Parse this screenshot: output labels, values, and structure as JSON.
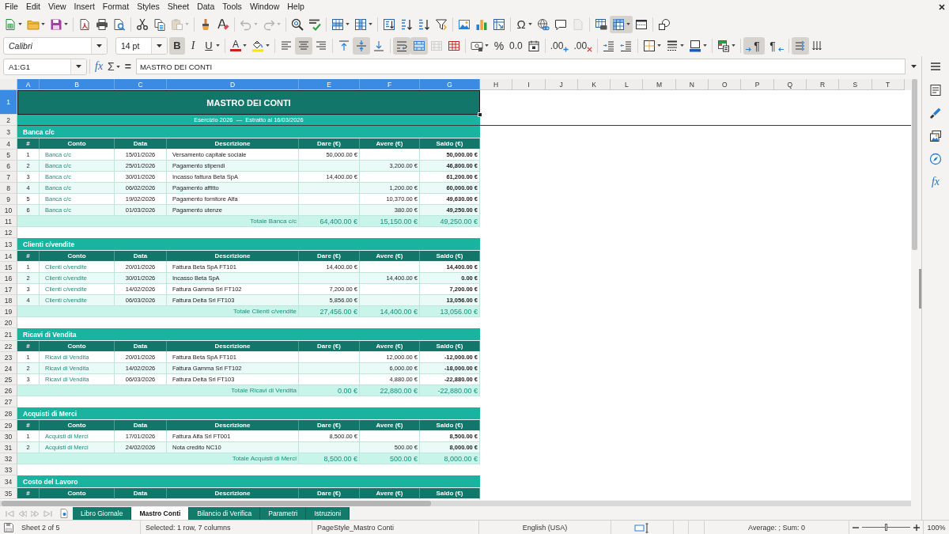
{
  "menu_bar": {
    "items": [
      "File",
      "Edit",
      "View",
      "Insert",
      "Format",
      "Styles",
      "Sheet",
      "Data",
      "Tools",
      "Window",
      "Help"
    ]
  },
  "standard_toolbar": {
    "paste": {
      "disabled": true
    },
    "undo": {
      "disabled": true
    },
    "redo": {
      "disabled": true
    },
    "special_character": {
      "label": "Ω"
    },
    "headers_footers": {
      "disabled": true
    },
    "freeze_rows_columns": {
      "on": true
    }
  },
  "formatting_toolbar": {
    "font_name": "Calibri",
    "font_size": "14 pt",
    "bold": {
      "label": "B",
      "on": true
    },
    "italic": {
      "label": "I",
      "on": false
    },
    "underline": {
      "label": "U",
      "on": false
    },
    "font_color": {
      "label": "A"
    },
    "align_left": {
      "on": false
    },
    "align_center": {
      "on": true
    },
    "align_right": {
      "on": false
    },
    "align_top": {
      "on": false
    },
    "center_vertically": {
      "on": true
    },
    "align_bottom": {
      "on": false
    },
    "wrap_text": {
      "on": true
    },
    "merge_and_center": {
      "on": true
    },
    "merge_cells": {
      "disabled": true
    },
    "percent": {
      "label": "%"
    },
    "number": {
      "label": "0.0"
    },
    "add_decimal_place": {
      "label": ".00"
    },
    "delete_decimal_place": {
      "label": ".00"
    },
    "left_to_right": {
      "label": "¶",
      "on": true
    },
    "right_to_left": {
      "label": "¶",
      "on": false
    },
    "text_left_to_right": {
      "on": true
    },
    "text_top_to_bottom": {
      "on": false
    }
  },
  "formula_bar": {
    "name_box": "A1:G1",
    "function_wizard": {
      "label": "fx"
    },
    "sum": {
      "label": "Σ"
    },
    "formula": {
      "label": "="
    },
    "content": "MASTRO DEI CONTI"
  },
  "sheet": {
    "columns": [
      {
        "label": "A",
        "selected": true
      },
      {
        "label": "B",
        "selected": true
      },
      {
        "label": "C",
        "selected": true
      },
      {
        "label": "D",
        "selected": true
      },
      {
        "label": "E",
        "selected": true
      },
      {
        "label": "F",
        "selected": true
      },
      {
        "label": "G",
        "selected": true
      },
      {
        "label": "H",
        "selected": false
      },
      {
        "label": "I",
        "selected": false
      },
      {
        "label": "J",
        "selected": false
      },
      {
        "label": "K",
        "selected": false
      },
      {
        "label": "L",
        "selected": false
      },
      {
        "label": "M",
        "selected": false
      },
      {
        "label": "N",
        "selected": false
      },
      {
        "label": "O",
        "selected": false
      },
      {
        "label": "P",
        "selected": false
      },
      {
        "label": "Q",
        "selected": false
      },
      {
        "label": "R",
        "selected": false
      },
      {
        "label": "S",
        "selected": false
      },
      {
        "label": "T",
        "selected": false
      }
    ],
    "rows": [
      {
        "number": "1",
        "selected": true,
        "kind": "title",
        "text": "MASTRO DEI CONTI"
      },
      {
        "number": "2",
        "selected": false,
        "kind": "subtitle",
        "text": "Esercizio 2026  —  Estratto al 16/03/2026"
      },
      {
        "number": "3",
        "selected": false,
        "kind": "section",
        "text": "Banca c/c"
      },
      {
        "number": "4",
        "selected": false,
        "kind": "column_headers",
        "cells": [
          "#",
          "Conto",
          "Data",
          "Descrizione",
          "Dare (€)",
          "Avere (€)",
          "Saldo (€)"
        ]
      },
      {
        "number": "5",
        "selected": false,
        "kind": "entry",
        "index": "1",
        "account": "Banca c/c",
        "date": "15/01/2026",
        "description": "Versamento capitale sociale",
        "debit": "50,000.00 €",
        "balance": "50,000.00 €"
      },
      {
        "number": "6",
        "selected": false,
        "kind": "entry",
        "index": "2",
        "account": "Banca c/c",
        "date": "25/01/2026",
        "description": "Pagamento stipendi",
        "credit": "3,200.00 €",
        "balance": "46,800.00 €"
      },
      {
        "number": "7",
        "selected": false,
        "kind": "entry",
        "index": "3",
        "account": "Banca c/c",
        "date": "30/01/2026",
        "description": "Incasso fattura Beta SpA",
        "debit": "14,400.00 €",
        "balance": "61,200.00 €"
      },
      {
        "number": "8",
        "selected": false,
        "kind": "entry",
        "index": "4",
        "account": "Banca c/c",
        "date": "06/02/2026",
        "description": "Pagamento affitto",
        "credit": "1,200.00 €",
        "balance": "60,000.00 €"
      },
      {
        "number": "9",
        "selected": false,
        "kind": "entry",
        "index": "5",
        "account": "Banca c/c",
        "date": "19/02/2026",
        "description": "Pagamento fornitore Alfa",
        "credit": "10,370.00 €",
        "balance": "49,630.00 €"
      },
      {
        "number": "10",
        "selected": false,
        "kind": "entry",
        "index": "6",
        "account": "Banca c/c",
        "date": "01/03/2026",
        "description": "Pagamento utenze",
        "credit": "380.00 €",
        "balance": "49,250.00 €"
      },
      {
        "number": "11",
        "selected": false,
        "kind": "total",
        "label": "Totale Banca c/c",
        "debit": "64,400.00 €",
        "credit": "15,150.00 €",
        "balance": "49,250.00 €"
      },
      {
        "number": "12",
        "selected": false,
        "kind": "blank"
      },
      {
        "number": "13",
        "selected": false,
        "kind": "section",
        "text": "Clienti c/vendite"
      },
      {
        "number": "14",
        "selected": false,
        "kind": "column_headers",
        "cells": [
          "#",
          "Conto",
          "Data",
          "Descrizione",
          "Dare (€)",
          "Avere (€)",
          "Saldo (€)"
        ]
      },
      {
        "number": "15",
        "selected": false,
        "kind": "entry",
        "index": "1",
        "account": "Clienti c/vendite",
        "date": "20/01/2026",
        "description": "Fattura Beta SpA FT101",
        "debit": "14,400.00 €",
        "balance": "14,400.00 €"
      },
      {
        "number": "16",
        "selected": false,
        "kind": "entry",
        "index": "2",
        "account": "Clienti c/vendite",
        "date": "30/01/2026",
        "description": "Incasso Beta SpA",
        "credit": "14,400.00 €",
        "balance": "0.00 €"
      },
      {
        "number": "17",
        "selected": false,
        "kind": "entry",
        "index": "3",
        "account": "Clienti c/vendite",
        "date": "14/02/2026",
        "description": "Fattura Gamma Srl FT102",
        "debit": "7,200.00 €",
        "balance": "7,200.00 €"
      },
      {
        "number": "18",
        "selected": false,
        "kind": "entry",
        "index": "4",
        "account": "Clienti c/vendite",
        "date": "06/03/2026",
        "description": "Fattura Delta Srl FT103",
        "debit": "5,856.00 €",
        "balance": "13,056.00 €"
      },
      {
        "number": "19",
        "selected": false,
        "kind": "total",
        "label": "Totale Clienti c/vendite",
        "debit": "27,456.00 €",
        "credit": "14,400.00 €",
        "balance": "13,056.00 €"
      },
      {
        "number": "20",
        "selected": false,
        "kind": "blank"
      },
      {
        "number": "21",
        "selected": false,
        "kind": "section",
        "text": "Ricavi di Vendita"
      },
      {
        "number": "22",
        "selected": false,
        "kind": "column_headers",
        "cells": [
          "#",
          "Conto",
          "Data",
          "Descrizione",
          "Dare (€)",
          "Avere (€)",
          "Saldo (€)"
        ]
      },
      {
        "number": "23",
        "selected": false,
        "kind": "entry",
        "index": "1",
        "account": "Ricavi di Vendita",
        "date": "20/01/2026",
        "description": "Fattura Beta SpA FT101",
        "credit": "12,000.00 €",
        "balance": "-12,000.00 €"
      },
      {
        "number": "24",
        "selected": false,
        "kind": "entry",
        "index": "2",
        "account": "Ricavi di Vendita",
        "date": "14/02/2026",
        "description": "Fattura Gamma Srl FT102",
        "credit": "6,000.00 €",
        "balance": "-18,000.00 €"
      },
      {
        "number": "25",
        "selected": false,
        "kind": "entry",
        "index": "3",
        "account": "Ricavi di Vendita",
        "date": "06/03/2026",
        "description": "Fattura Delta Srl FT103",
        "credit": "4,880.00 €",
        "balance": "-22,880.00 €"
      },
      {
        "number": "26",
        "selected": false,
        "kind": "total",
        "label": "Totale Ricavi di Vendita",
        "debit": "0.00 €",
        "credit": "22,880.00 €",
        "balance": "-22,880.00 €"
      },
      {
        "number": "27",
        "selected": false,
        "kind": "blank"
      },
      {
        "number": "28",
        "selected": false,
        "kind": "section",
        "text": "Acquisti di Merci"
      },
      {
        "number": "29",
        "selected": false,
        "kind": "column_headers",
        "cells": [
          "#",
          "Conto",
          "Data",
          "Descrizione",
          "Dare (€)",
          "Avere (€)",
          "Saldo (€)"
        ]
      },
      {
        "number": "30",
        "selected": false,
        "kind": "entry",
        "index": "1",
        "account": "Acquisti di Merci",
        "date": "17/01/2026",
        "description": "Fattura Alfa Srl FT001",
        "debit": "8,500.00 €",
        "balance": "8,500.00 €"
      },
      {
        "number": "31",
        "selected": false,
        "kind": "entry",
        "index": "2",
        "account": "Acquisti di Merci",
        "date": "24/02/2026",
        "description": "Nota credito NC10",
        "credit": "500.00 €",
        "balance": "8,000.00 €"
      },
      {
        "number": "32",
        "selected": false,
        "kind": "total",
        "label": "Totale Acquisti di Merci",
        "debit": "8,500.00 €",
        "credit": "500.00 €",
        "balance": "8,000.00 €"
      },
      {
        "number": "33",
        "selected": false,
        "kind": "blank"
      },
      {
        "number": "34",
        "selected": false,
        "kind": "section",
        "text": "Costo del Lavoro"
      },
      {
        "number": "35",
        "selected": false,
        "kind": "column_headers",
        "cells": [
          "#",
          "Conto",
          "Data",
          "Descrizione",
          "Dare (€)",
          "Avere (€)",
          "Saldo (€)"
        ]
      }
    ]
  },
  "sheet_tabs": {
    "scroll_buttons": {
      "disabled": true
    },
    "tabs": [
      {
        "label": "Libro Giornale",
        "selected": false
      },
      {
        "label": "Mastro Conti",
        "selected": true
      },
      {
        "label": "Bilancio di Verifica",
        "selected": false
      },
      {
        "label": "Parametri",
        "selected": false
      },
      {
        "label": "Istruzioni",
        "selected": false
      }
    ]
  },
  "sidebar": {
    "functions": {
      "label": "fx"
    }
  },
  "status_bar": {
    "sheet_position": "Sheet 2 of 5",
    "selection": "Selected: 1 row, 7 columns",
    "page_style": "PageStyle_Mastro Conti",
    "language": "English (USA)",
    "sum": "Average: ; Sum: 0",
    "zoom": {
      "level": 0.5,
      "reading": "100%"
    }
  }
}
